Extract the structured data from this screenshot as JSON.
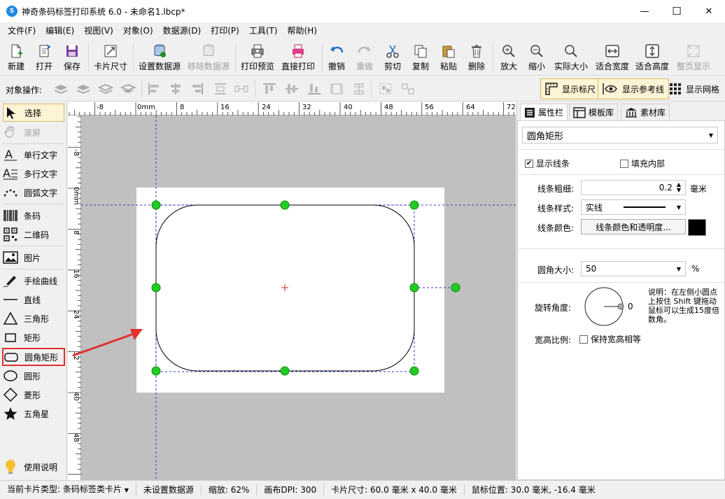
{
  "window": {
    "title": "神奇条码标签打印系统 6.0 - 未命名1.lbcp*",
    "minimize": "—",
    "maximize": "☐",
    "close": "✕"
  },
  "menu": [
    "文件(F)",
    "编辑(E)",
    "视图(V)",
    "对象(O)",
    "数据源(D)",
    "打印(P)",
    "工具(T)",
    "帮助(H)"
  ],
  "toolbar": {
    "new": "新建",
    "open": "打开",
    "save": "保存",
    "card_size": "卡片尺寸",
    "set_datasource": "设置数据源",
    "remove_datasource": "移除数据源",
    "print_preview": "打印预览",
    "direct_print": "直接打印",
    "undo": "撤销",
    "redo": "重做",
    "cut": "剪切",
    "copy": "复制",
    "paste": "粘贴",
    "delete": "删除",
    "zoom_in": "放大",
    "zoom_out": "缩小",
    "actual_size": "实际大小",
    "fit_width": "适合宽度",
    "fit_height": "适合高度",
    "fit_page": "整页显示"
  },
  "objbar": {
    "label": "对象操作:",
    "show_ruler": "显示标尺",
    "show_guides": "显示参考线",
    "show_grid": "显示网格"
  },
  "tools": {
    "select": "选择",
    "scroll": "滚屏",
    "single_text": "单行文字",
    "multi_text": "多行文字",
    "arc_text": "圆弧文字",
    "barcode": "条码",
    "qrcode": "二维码",
    "image": "图片",
    "freehand": "手绘曲线",
    "line": "直线",
    "triangle": "三角形",
    "rectangle": "矩形",
    "rounded_rect": "圆角矩形",
    "circle": "圆形",
    "diamond": "菱形",
    "star": "五角星",
    "help": "使用说明"
  },
  "ruler": {
    "h_labels": [
      "-8",
      "0mm",
      "8",
      "16",
      "24",
      "32",
      "40",
      "48",
      "56",
      "64",
      "72"
    ],
    "v_labels": [
      "-8",
      "0mm",
      "8",
      "16",
      "24",
      "32",
      "40",
      "48"
    ]
  },
  "props": {
    "tabs": [
      "属性栏",
      "模板库",
      "素材库"
    ],
    "object_type": "圆角矩形",
    "show_line": "显示线条",
    "show_line_checked": true,
    "fill_inside": "填充内部",
    "fill_inside_checked": false,
    "line_width_label": "线条粗细:",
    "line_width": "0.2",
    "line_width_unit": "毫米",
    "line_style_label": "线条样式:",
    "line_style": "实线",
    "line_color_label": "线条颜色:",
    "line_color_button": "线条颜色和透明度...",
    "line_color": "#000000",
    "corner_label": "圆角大小:",
    "corner_value": "50",
    "corner_unit": "%",
    "rotation_label": "旋转角度:",
    "rotation_value": "0",
    "rotation_note": "说明：在左侧小圆点上按住 Shift 键拖动鼠标可以生成15度倍数角。",
    "ratio_label": "宽高比例:",
    "keep_ratio": "保持宽高相等",
    "keep_ratio_checked": false
  },
  "status": {
    "card_type": "当前卡片类型: 条码标签类卡片",
    "datasource": "未设置数据源",
    "zoom": "缩放: 62%",
    "dpi": "画布DPI: 300",
    "card_size": "卡片尺寸: 60.0 毫米 x 40.0 毫米",
    "mouse_pos": "鼠标位置: 30.0 毫米, -16.4 毫米"
  },
  "colors": {
    "accent_bg": "#fdf3d5",
    "handle": "#22cc22",
    "guide": "#3333cc",
    "highlight": "#e03030",
    "canvas_bg": "#c0c0c0"
  }
}
